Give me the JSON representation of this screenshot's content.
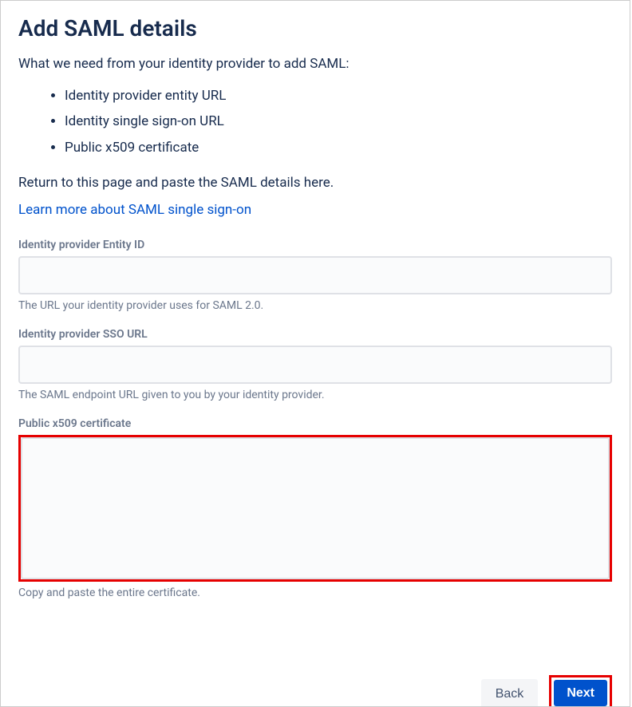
{
  "heading": "Add SAML details",
  "intro": "What we need from your identity provider to add SAML:",
  "requirements": [
    "Identity provider entity URL",
    "Identity single sign-on URL",
    "Public x509 certificate"
  ],
  "return_text": "Return to this page and paste the SAML details here.",
  "learn_more": "Learn more about SAML single sign-on",
  "fields": {
    "entity_id": {
      "label": "Identity provider Entity ID",
      "value": "",
      "helper": "The URL your identity provider uses for SAML 2.0."
    },
    "sso_url": {
      "label": "Identity provider SSO URL",
      "value": "",
      "helper": "The SAML endpoint URL given to you by your identity provider."
    },
    "certificate": {
      "label": "Public x509 certificate",
      "value": "",
      "helper": "Copy and paste the entire certificate."
    }
  },
  "buttons": {
    "back": "Back",
    "next": "Next"
  }
}
